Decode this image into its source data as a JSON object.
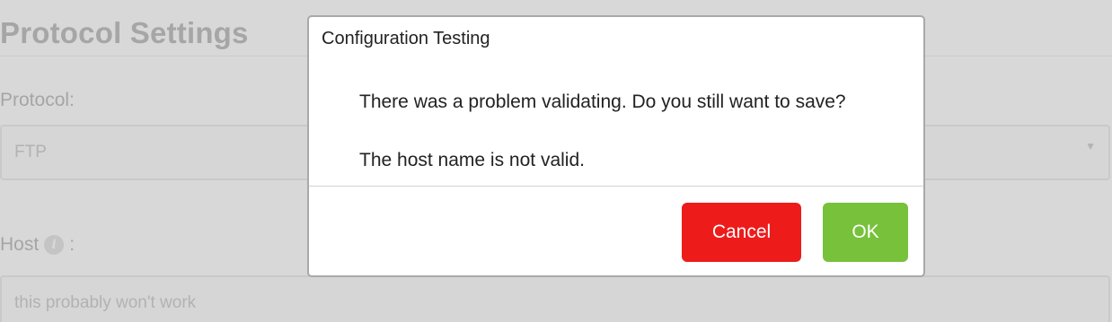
{
  "background": {
    "title": "Protocol Settings",
    "protocol_label": "Protocol:",
    "protocol_value": "FTP",
    "host_label": "Host",
    "host_label_suffix": ":",
    "host_info_icon": "info-icon",
    "host_value": "this probably won't work"
  },
  "dialog": {
    "title": "Configuration Testing",
    "message": "There was a problem validating. Do you still want to save?",
    "detail": "The host name is not valid.",
    "cancel_label": "Cancel",
    "ok_label": "OK",
    "colors": {
      "cancel": "#ee1b1b",
      "ok": "#77c13b"
    }
  }
}
